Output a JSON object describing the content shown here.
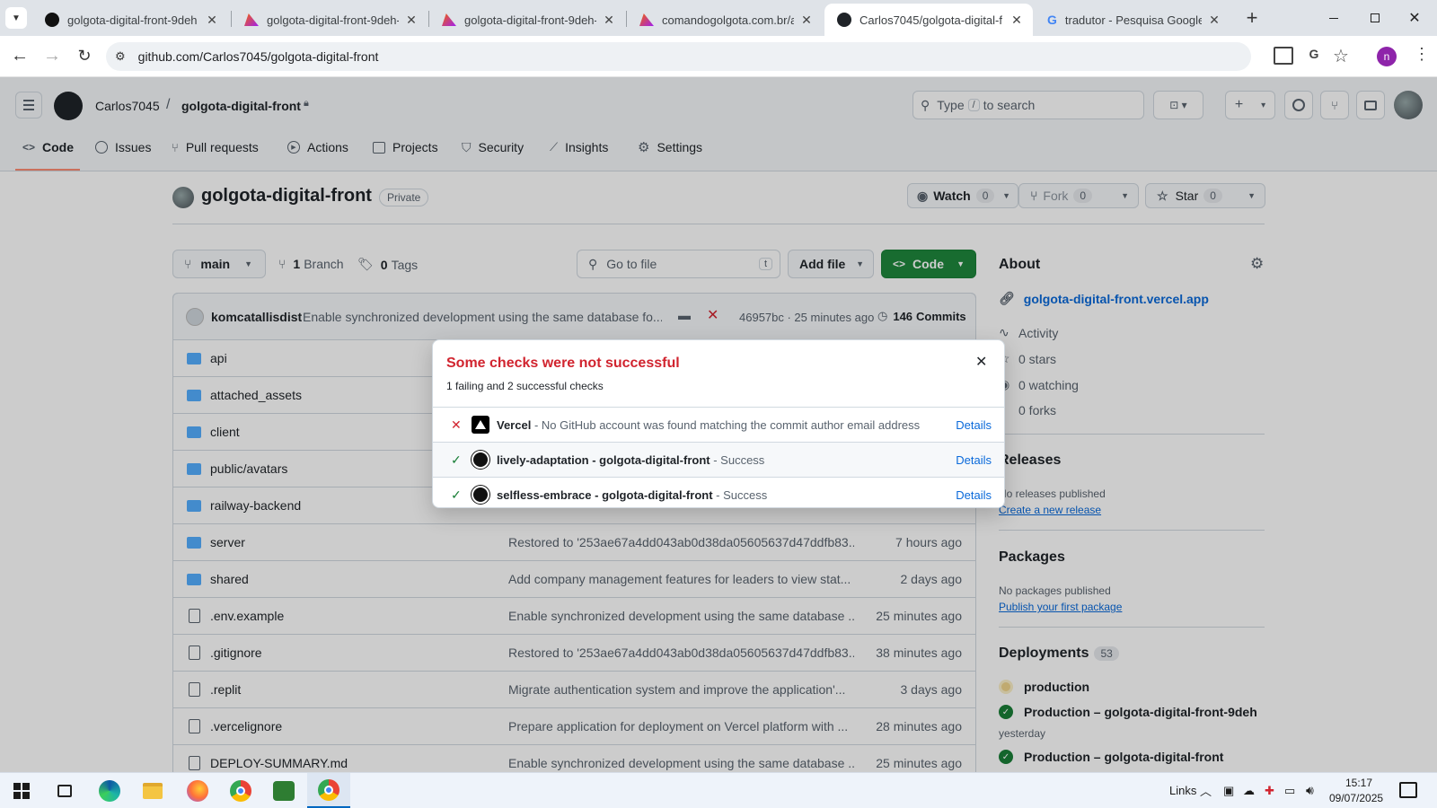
{
  "browser": {
    "tabs": [
      {
        "title": "golgota-digital-front-9deh -"
      },
      {
        "title": "golgota-digital-front-9deh-e"
      },
      {
        "title": "golgota-digital-front-9deh-g"
      },
      {
        "title": "comandogolgota.com.br/aut"
      },
      {
        "title": "Carlos7045/golgota-digital-f"
      },
      {
        "title": "tradutor - Pesquisa Google"
      }
    ],
    "url": "github.com/Carlos7045/golgota-digital-front",
    "profile_initial": "n"
  },
  "header": {
    "owner": "Carlos7045",
    "separator": "/",
    "repo": "golgota-digital-front",
    "search_type": "Type",
    "search_key": "/",
    "search_rest": "to search"
  },
  "nav": {
    "tabs": [
      "Code",
      "Issues",
      "Pull requests",
      "Actions",
      "Projects",
      "Security",
      "Insights",
      "Settings"
    ]
  },
  "repo": {
    "name": "golgota-digital-front",
    "visibility": "Private",
    "watch_label": "Watch",
    "watch_count": "0",
    "fork_label": "Fork",
    "fork_count": "0",
    "star_label": "Star",
    "star_count": "0"
  },
  "toolbar": {
    "branch": "main",
    "branches_count": "1",
    "branches_label": "Branch",
    "tags_count": "0",
    "tags_label": "Tags",
    "go_to_file": "Go to file",
    "go_to_file_key": "t",
    "add_file": "Add file",
    "code": "Code"
  },
  "commit": {
    "author": "komcatallisdist",
    "message": "Enable synchronized development using the same database fo...",
    "sha_time": "46957bc · 25 minutes ago",
    "commits_count": "146",
    "commits_label": "Commits"
  },
  "files": [
    {
      "name": "api",
      "type": "dir",
      "message": "",
      "time": ""
    },
    {
      "name": "attached_assets",
      "type": "dir",
      "message": "",
      "time": ""
    },
    {
      "name": "client",
      "type": "dir",
      "message": "",
      "time": ""
    },
    {
      "name": "public/avatars",
      "type": "dir",
      "message": "",
      "time": ""
    },
    {
      "name": "railway-backend",
      "type": "dir",
      "message": "",
      "time": ""
    },
    {
      "name": "server",
      "type": "dir",
      "message": "Restored to '253ae67a4dd043ab0d38da05605637d47ddfb83...",
      "time": "7 hours ago"
    },
    {
      "name": "shared",
      "type": "dir",
      "message": "Add company management features for leaders to view stat...",
      "time": "2 days ago"
    },
    {
      "name": ".env.example",
      "type": "file",
      "message": "Enable synchronized development using the same database ...",
      "time": "25 minutes ago"
    },
    {
      "name": ".gitignore",
      "type": "file",
      "message": "Restored to '253ae67a4dd043ab0d38da05605637d47ddfb83...",
      "time": "38 minutes ago"
    },
    {
      "name": ".replit",
      "type": "file",
      "message": "Migrate authentication system and improve the application'...",
      "time": "3 days ago"
    },
    {
      "name": ".vercelignore",
      "type": "file",
      "message": "Prepare application for deployment on Vercel platform with ...",
      "time": "28 minutes ago"
    },
    {
      "name": "DEPLOY-SUMMARY.md",
      "type": "file",
      "message": "Enable synchronized development using the same database ...",
      "time": "25 minutes ago"
    }
  ],
  "about": {
    "title": "About",
    "website": "golgota-digital-front.vercel.app",
    "activity": "Activity",
    "stars": "0 stars",
    "watching": "0 watching",
    "forks": "0 forks"
  },
  "releases": {
    "title": "Releases",
    "none": "No releases published",
    "create": "Create a new release"
  },
  "packages": {
    "title": "Packages",
    "none": "No packages published",
    "publish": "Publish your first package"
  },
  "deployments": {
    "title": "Deployments",
    "count": "53",
    "production": "production",
    "items": [
      {
        "name": "Production – golgota-digital-front-9deh",
        "time": "yesterday"
      },
      {
        "name": "Production – golgota-digital-front"
      }
    ]
  },
  "checks_popup": {
    "title": "Some checks were not successful",
    "subtitle": "1 failing and 2 successful checks",
    "details_label": "Details",
    "checks": [
      {
        "status": "failure",
        "name": "Vercel",
        "description": "- No GitHub account was found matching the commit author email address"
      },
      {
        "status": "success",
        "name": "lively-adaptation - golgota-digital-front",
        "description": "- Success"
      },
      {
        "status": "success",
        "name": "selfless-embrace - golgota-digital-front",
        "description": "- Success"
      }
    ]
  },
  "taskbar": {
    "links_label": "Links",
    "time": "15:17",
    "date": "09/07/2025"
  },
  "colors": {
    "danger": "#d1242f",
    "success": "#1a7f37",
    "primary": "#1f883d",
    "accent": "#0969da"
  }
}
